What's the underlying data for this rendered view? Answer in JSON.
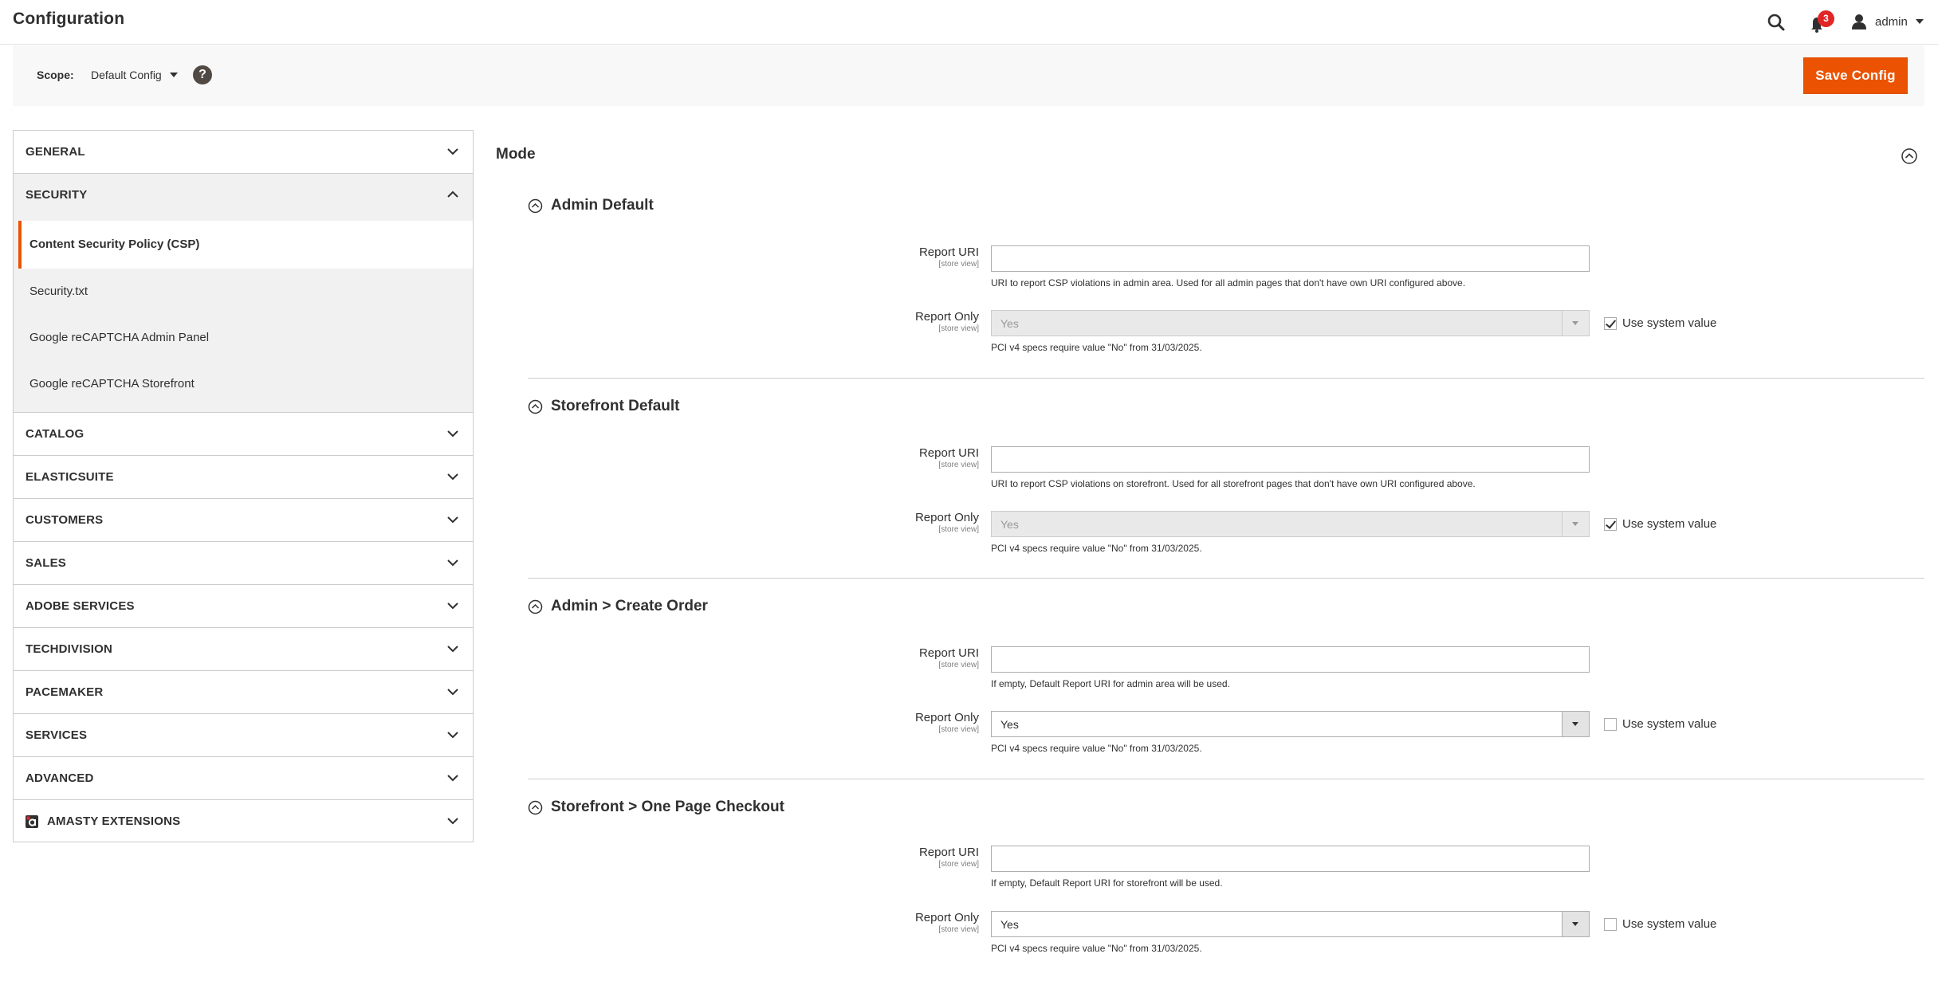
{
  "header": {
    "title": "Configuration",
    "notifications_count": "3",
    "user_name": "admin"
  },
  "scope": {
    "label": "Scope:",
    "value": "Default Config",
    "help": "?",
    "save_label": "Save Config"
  },
  "sidebar": {
    "sections_before": [
      {
        "label": "GENERAL"
      }
    ],
    "security": {
      "label": "SECURITY",
      "items": [
        {
          "label": "Content Security Policy (CSP)"
        },
        {
          "label": "Security.txt"
        },
        {
          "label": "Google reCAPTCHA Admin Panel"
        },
        {
          "label": "Google reCAPTCHA Storefront"
        }
      ]
    },
    "sections_after": [
      {
        "label": "CATALOG"
      },
      {
        "label": "ELASTICSUITE"
      },
      {
        "label": "CUSTOMERS"
      },
      {
        "label": "SALES"
      },
      {
        "label": "ADOBE SERVICES"
      },
      {
        "label": "TECHDIVISION"
      },
      {
        "label": "PACEMAKER"
      },
      {
        "label": "SERVICES"
      },
      {
        "label": "ADVANCED"
      },
      {
        "label": "AMASTY EXTENSIONS"
      }
    ]
  },
  "main": {
    "section_title": "Mode",
    "groups": [
      {
        "title": "Admin Default",
        "report_uri_label": "Report URI",
        "report_uri_scope": "[store view]",
        "report_uri_value": "",
        "report_uri_note": "URI to report CSP violations in admin area. Used for all admin pages that don't have own URI configured above.",
        "report_only_label": "Report Only",
        "report_only_scope": "[store view]",
        "report_only_value": "Yes",
        "report_only_note": "PCI v4 specs require value \"No\" from 31/03/2025.",
        "use_system_label": "Use system value"
      },
      {
        "title": "Storefront Default",
        "report_uri_label": "Report URI",
        "report_uri_scope": "[store view]",
        "report_uri_value": "",
        "report_uri_note": "URI to report CSP violations on storefront. Used for all storefront pages that don't have own URI configured above.",
        "report_only_label": "Report Only",
        "report_only_scope": "[store view]",
        "report_only_value": "Yes",
        "report_only_note": "PCI v4 specs require value \"No\" from 31/03/2025.",
        "use_system_label": "Use system value"
      },
      {
        "title": "Admin > Create Order",
        "report_uri_label": "Report URI",
        "report_uri_scope": "[store view]",
        "report_uri_value": "",
        "report_uri_note": "If empty, Default Report URI for admin area will be used.",
        "report_only_label": "Report Only",
        "report_only_scope": "[store view]",
        "report_only_value": "Yes",
        "report_only_note": "PCI v4 specs require value \"No\" from 31/03/2025.",
        "use_system_label": "Use system value"
      },
      {
        "title": "Storefront > One Page Checkout",
        "report_uri_label": "Report URI",
        "report_uri_scope": "[store view]",
        "report_uri_value": "",
        "report_uri_note": "If empty, Default Report URI for storefront will be used.",
        "report_only_label": "Report Only",
        "report_only_scope": "[store view]",
        "report_only_value": "Yes",
        "report_only_note": "PCI v4 specs require value \"No\" from 31/03/2025.",
        "use_system_label": "Use system value"
      }
    ]
  },
  "colors": {
    "accent": "#eb5202",
    "badge": "#e22626",
    "help": "#514943"
  }
}
